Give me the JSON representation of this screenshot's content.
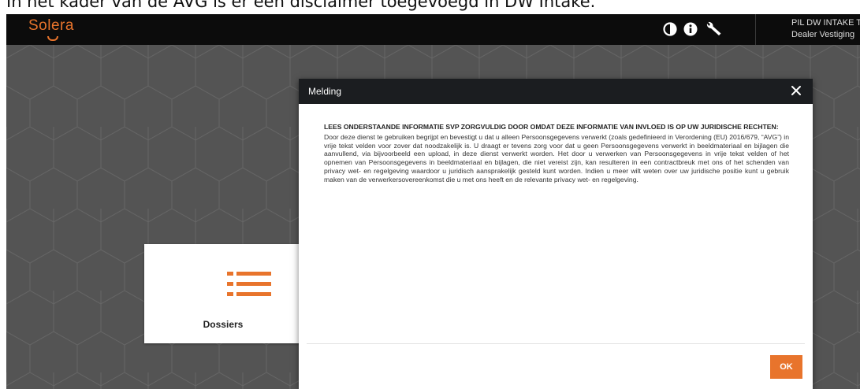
{
  "caption": "In het kader van de AVG is er een disclaimer toegevoegd in DW Intake.",
  "header": {
    "logo_text": "Solеra",
    "user": {
      "name": "PIL DW INTAKE T",
      "location": "Dealer Vestiging"
    },
    "icons": [
      "contrast-icon",
      "info-icon",
      "wrench-icon"
    ]
  },
  "tile": {
    "label": "Dossiers",
    "icon": "list-icon"
  },
  "modal": {
    "title": "Melding",
    "heading": "LEES ONDERSTAANDE INFORMATIE SVP ZORGVULDIG DOOR OMDAT DEZE INFORMATIE VAN INVLOED IS OP UW JURIDISCHE RECHTEN:",
    "body": "Door deze dienst te gebruiken begrijpt en bevestigt u dat u alleen Persoonsgegevens verwerkt (zoals gedefinieerd in Verordening (EU) 2016/679, “AVG”) in vrije tekst velden voor zover dat noodzakelijk is. U draagt er tevens zorg voor dat u geen Persoonsgegevens verwerkt in beeldmateriaal en bijlagen die aanvullend, via bijvoorbeeld een upload, in deze dienst verwerkt worden. Het door u verwerken van Persoonsgegevens in vrije tekst velden of het opnemen van Persoonsgegevens in beeldmateriaal en bijlagen, die niet vereist zijn, kan resulteren in een contractbreuk met ons of het schenden van privacy wet- en regelgeving waardoor u juridisch aansprakelijk gesteld kunt worden. Indien u meer wilt weten over uw juridische positie kunt u gebruik maken van de verwerkersovereenkomst die u met ons heeft en de relevante privacy wet- en regelgeving.",
    "ok_label": "OK"
  },
  "colors": {
    "accent": "#e8742c",
    "topbar": "#0c0c0c",
    "modal_header": "#1b1d20",
    "background": "#545454"
  }
}
